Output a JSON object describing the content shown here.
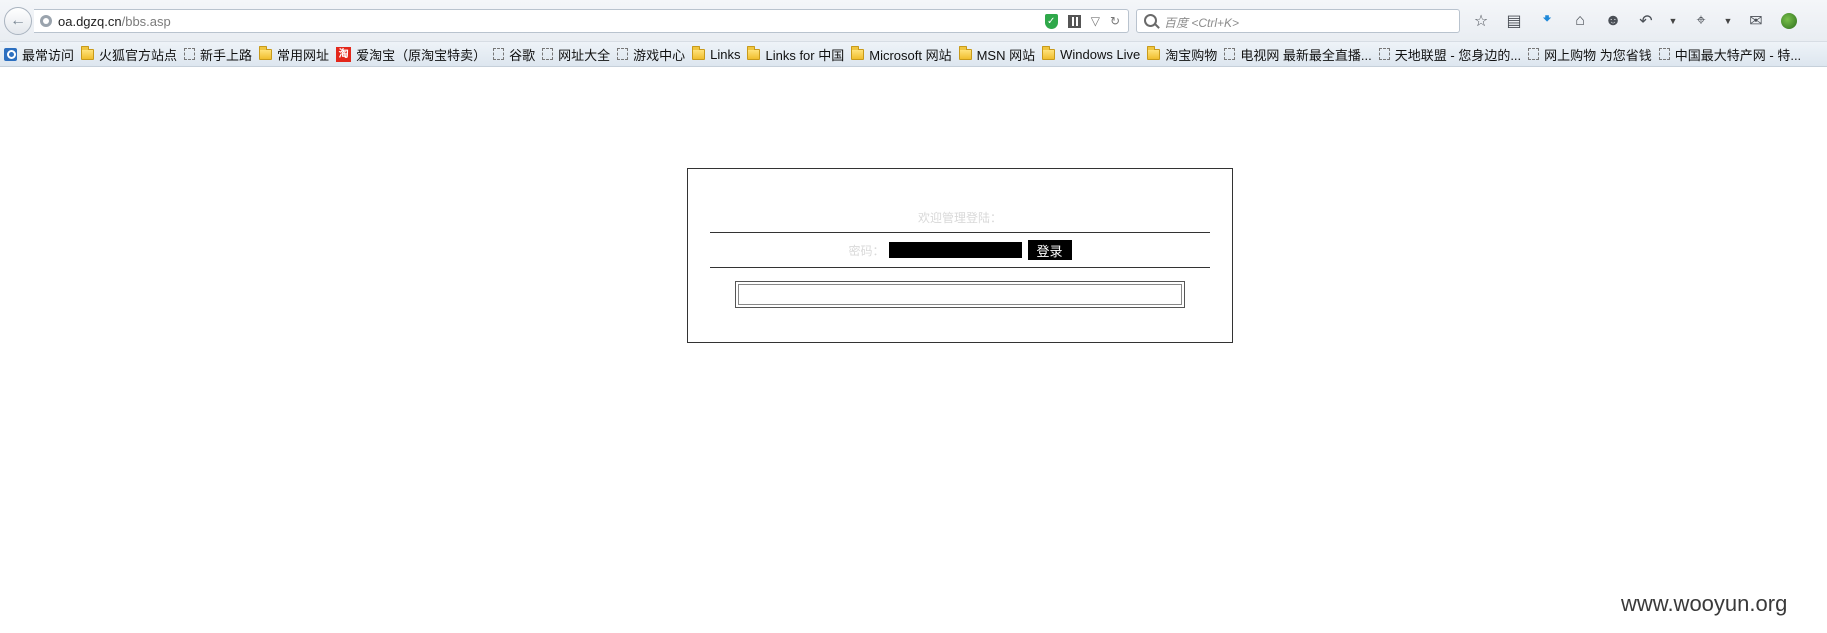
{
  "browser": {
    "url_host": "oa.dgzq.cn",
    "url_path": "/bbs.asp",
    "search_placeholder": "百度 <Ctrl+K>",
    "toolbar_icons": [
      "star-icon",
      "reading-list-icon",
      "download-icon",
      "home-icon",
      "chat-icon",
      "undo-icon",
      "dropdown-icon",
      "crop-icon",
      "dropdown-icon",
      "message-icon",
      "addon-icon"
    ]
  },
  "bookmarks": [
    {
      "icon": "search",
      "label": "最常访问"
    },
    {
      "icon": "folder",
      "label": "火狐官方站点"
    },
    {
      "icon": "page",
      "label": "新手上路"
    },
    {
      "icon": "folder",
      "label": "常用网址"
    },
    {
      "icon": "tao",
      "label": "爱淘宝（原淘宝特卖）"
    },
    {
      "icon": "page",
      "label": "谷歌"
    },
    {
      "icon": "page",
      "label": "网址大全"
    },
    {
      "icon": "page",
      "label": "游戏中心"
    },
    {
      "icon": "folder",
      "label": "Links"
    },
    {
      "icon": "folder",
      "label": "Links for 中国"
    },
    {
      "icon": "folder",
      "label": "Microsoft 网站"
    },
    {
      "icon": "folder",
      "label": "MSN 网站"
    },
    {
      "icon": "folder",
      "label": "Windows Live"
    },
    {
      "icon": "folder",
      "label": "淘宝购物"
    },
    {
      "icon": "page",
      "label": "电视网 最新最全直播..."
    },
    {
      "icon": "page",
      "label": "天地联盟 - 您身边的..."
    },
    {
      "icon": "page",
      "label": "网上购物 为您省钱"
    },
    {
      "icon": "page",
      "label": "中国最大特产网 - 特..."
    }
  ],
  "login": {
    "welcome_text": "欢迎管理登陆：",
    "password_label": "密码：",
    "password_value": "",
    "login_button": "登录",
    "message_value": ""
  },
  "watermark": "www.wooyun.org"
}
